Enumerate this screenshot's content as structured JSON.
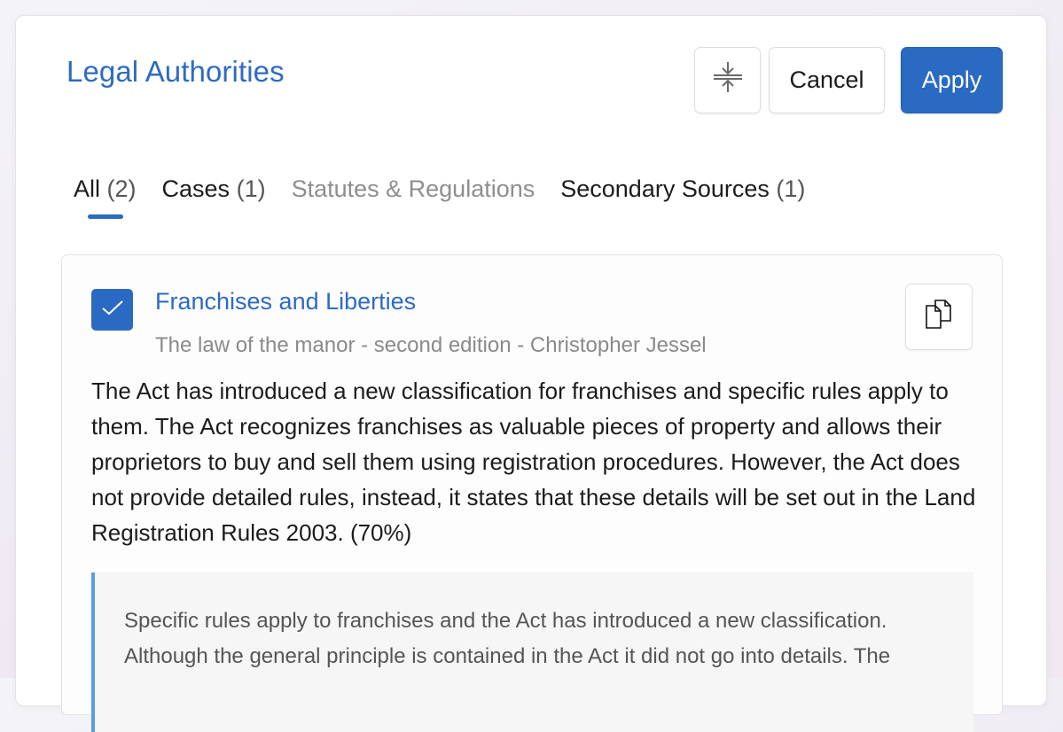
{
  "header": {
    "title": "Legal Authorities",
    "collapse_icon": "collapse-vertical-icon",
    "cancel_label": "Cancel",
    "apply_label": "Apply"
  },
  "tabs": [
    {
      "label": "All",
      "count": "(2)",
      "active": true,
      "disabled": false
    },
    {
      "label": "Cases",
      "count": "(1)",
      "active": false,
      "disabled": false
    },
    {
      "label": "Statutes & Regulations",
      "count": "",
      "active": false,
      "disabled": true
    },
    {
      "label": "Secondary Sources",
      "count": "(1)",
      "active": false,
      "disabled": false
    }
  ],
  "results": [
    {
      "checked": true,
      "title": "Franchises and Liberties",
      "subtitle": "The law of the manor - second edition - Christopher Jessel",
      "copy_icon": "copy-icon",
      "summary": "The Act has introduced a new classification for franchises and specific rules apply to them. The Act recognizes franchises as valuable pieces of property and allows their proprietors to buy and sell them using registration procedures. However, the Act does not provide detailed rules, instead, it states that these details will be set out in the Land Registration Rules 2003. (70%)",
      "quote": "Specific rules apply to franchises and the Act has introduced a new classification. Although the general principle is contained in the Act it did not go into details. The"
    }
  ],
  "colors": {
    "accent": "#2b6ac2",
    "quote_border": "#5b9be4"
  }
}
